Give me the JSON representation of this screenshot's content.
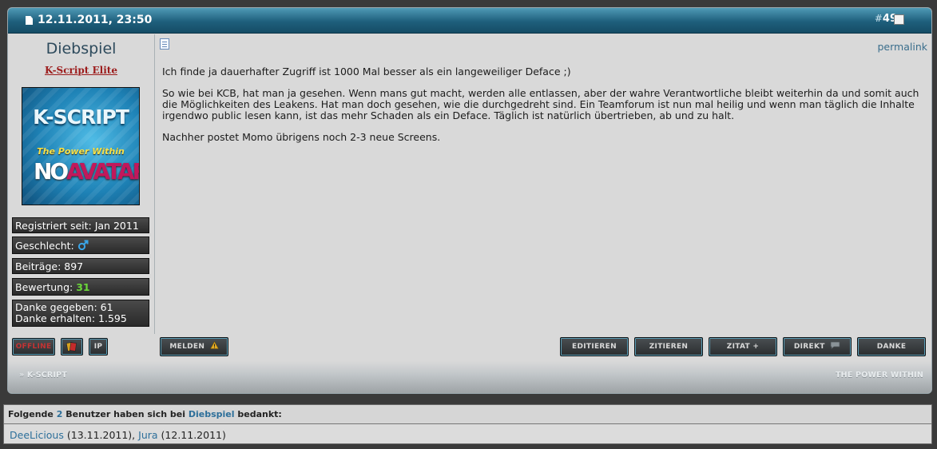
{
  "post": {
    "date": "12.11.2011, 23:50",
    "number_prefix": "#",
    "number": "49",
    "permalink": "permalink"
  },
  "user": {
    "name": "Diebspiel",
    "title": "K-Script Elite",
    "avatar": {
      "line1": "K-SCRIPT",
      "line2": "The Power Within",
      "no": "NO",
      "avatar": "AVATAR"
    },
    "stats": {
      "registered": "Registriert seit: Jan 2011",
      "gender_label": "Geschlecht:",
      "posts": "Beiträge: 897",
      "rating_label": "Bewertung:",
      "rating_value": "31",
      "thanks_given": "Danke gegeben: 61",
      "thanks_received": "Danke erhalten: 1.595"
    }
  },
  "message": {
    "p1": "Ich finde ja dauerhafter Zugriff ist 1000 Mal besser als ein langeweiliger Deface ;)",
    "p2": "So wie bei KCB, hat man ja gesehen. Wenn mans gut macht, werden alle entlassen, aber der wahre Verantwortliche bleibt weiterhin da und somit auch die Möglichkeiten des Leakens. Hat man doch gesehen, wie die durchgedreht sind. Ein Teamforum ist nun mal heilig und wenn man täglich die Inhalte irgendwo public lesen kann, ist das mehr Schaden als ein Deface. Täglich ist natürlich übertrieben, ab und zu halt.",
    "p3": "Nachher postet Momo übrigens noch 2-3 neue Screens."
  },
  "buttons": {
    "offline": "OFFLINE",
    "ip": "IP",
    "melden": "MELDEN",
    "editieren": "EDITIEREN",
    "zitieren": "ZITIEREN",
    "zitat_plus": "ZITAT +",
    "direkt": "DIREKT",
    "danke": "DANKE"
  },
  "footer": {
    "left": "» K-SCRIPT",
    "right": "THE POWER WITHIN"
  },
  "thanks_box": {
    "prefix": "Folgende",
    "count": "2",
    "middle": "Benutzer haben sich bei",
    "user": "Diebspiel",
    "suffix": "bedankt:",
    "user1": "DeeLicious",
    "date1": "(13.11.2011),",
    "user2": "Jura",
    "date2": "(12.11.2011)"
  },
  "colors": {
    "header": "#1e5f7c",
    "accent_link": "#2d6f9a",
    "rating_green": "#6bd73a",
    "usertitle_red": "#9c1c1c"
  }
}
